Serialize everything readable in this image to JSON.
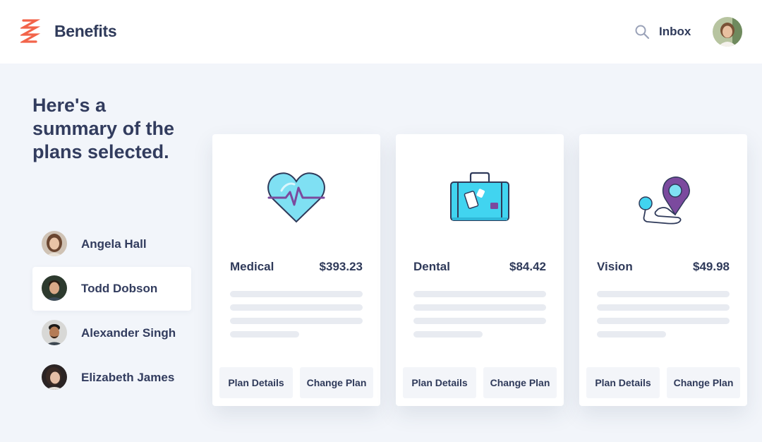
{
  "header": {
    "brand": "Benefits",
    "inbox_label": "Inbox",
    "logo_color": "#f2644a"
  },
  "headline": "Here's a summary of the plans selected.",
  "people": [
    {
      "name": "Angela Hall",
      "active": false
    },
    {
      "name": "Todd Dobson",
      "active": true
    },
    {
      "name": "Alexander Singh",
      "active": false
    },
    {
      "name": "Elizabeth James",
      "active": false
    }
  ],
  "plans": [
    {
      "name": "Medical",
      "price": "$393.23",
      "icon": "heart-pulse-icon",
      "details_label": "Plan Details",
      "change_label": "Change Plan"
    },
    {
      "name": "Dental",
      "price": "$84.42",
      "icon": "suitcase-icon",
      "details_label": "Plan Details",
      "change_label": "Change Plan"
    },
    {
      "name": "Vision",
      "price": "$49.98",
      "icon": "map-pin-icon",
      "details_label": "Plan Details",
      "change_label": "Change Plan"
    }
  ],
  "colors": {
    "accent_cyan": "#41d4f0",
    "accent_purple": "#7b4a9e",
    "text": "#2f3a5a",
    "background": "#f2f5fa"
  }
}
